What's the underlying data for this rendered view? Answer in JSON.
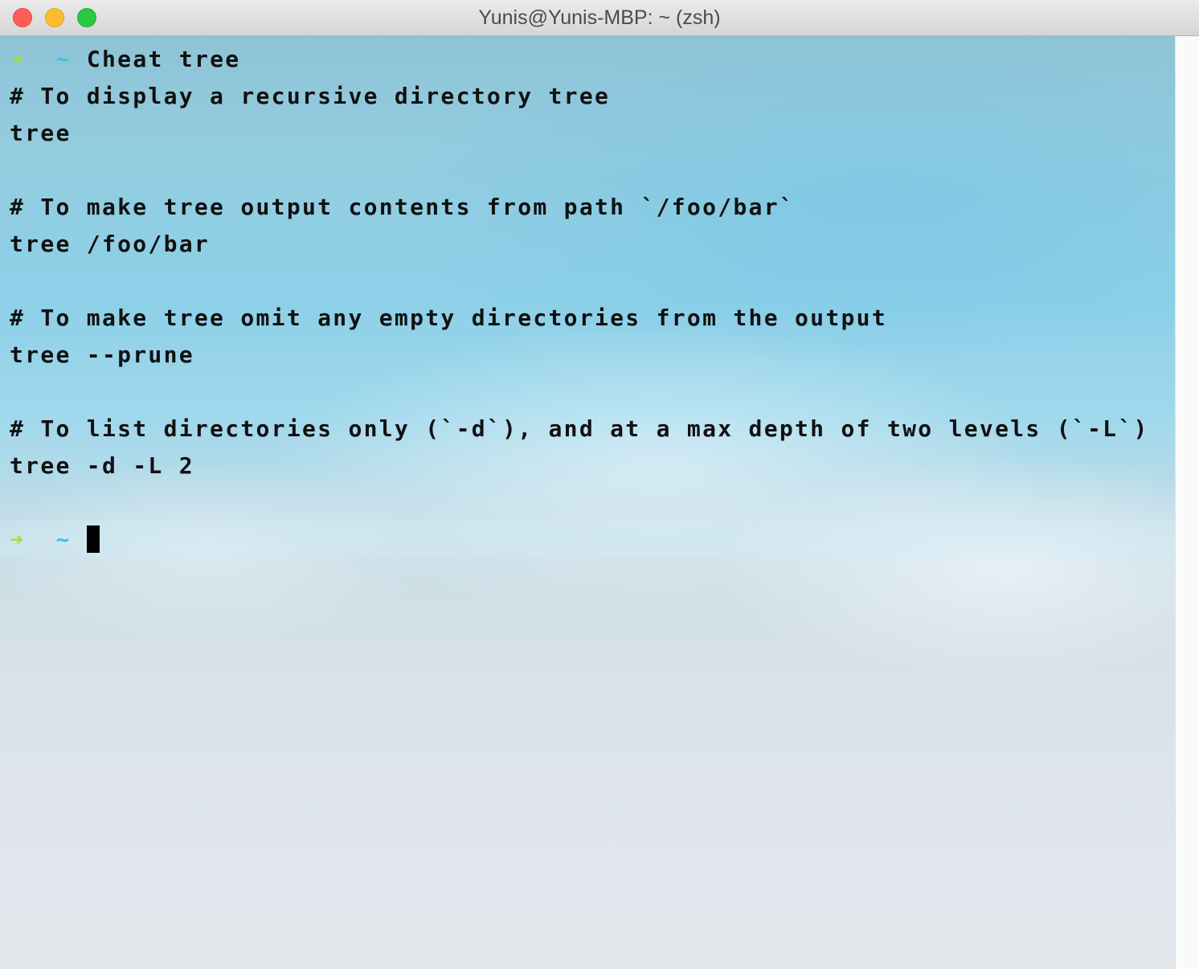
{
  "window": {
    "title": "Yunis@Yunis-MBP: ~ (zsh)"
  },
  "terminal": {
    "prompt_arrow": "➜",
    "prompt_dir": "~",
    "command": "Cheat tree",
    "output": [
      "# To display a recursive directory tree",
      "tree",
      "",
      "# To make tree output contents from path `/foo/bar`",
      "tree /foo/bar",
      "",
      "# To make tree omit any empty directories from the output",
      "tree --prune",
      "",
      "# To list directories only (`-d`), and at a max depth of two levels (`-L`)",
      "tree -d -L 2",
      ""
    ],
    "current_input": ""
  },
  "colors": {
    "prompt_arrow": "#9be23b",
    "prompt_dir": "#32c8e4",
    "text": "#111111",
    "close": "#fc5f57",
    "minimize": "#fdbc2e",
    "zoom": "#29c840"
  }
}
